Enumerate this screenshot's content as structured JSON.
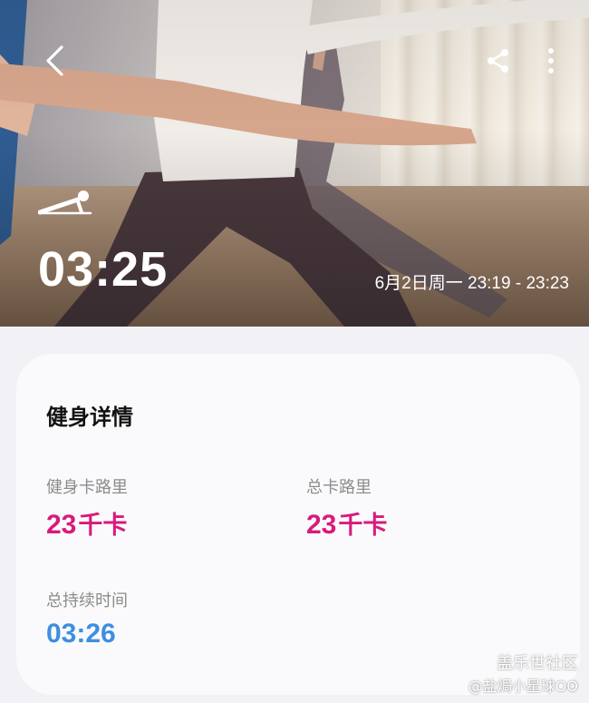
{
  "hero": {
    "duration": "03:25",
    "session_time": "6月2日周一 23:19 - 23:23"
  },
  "icons": {
    "back": "chevron-left-icon",
    "share": "share-icon",
    "more": "more-vertical-icon",
    "workout": "workout-plank-icon"
  },
  "details": {
    "title": "健身详情",
    "metrics": [
      {
        "label": "健身卡路里",
        "value": "23",
        "unit": "千卡"
      },
      {
        "label": "总卡路里",
        "value": "23",
        "unit": "千卡"
      },
      {
        "label": "总持续时间",
        "value": "03:26"
      }
    ]
  },
  "watermark": {
    "line1": "盖乐世社区",
    "line2": "@盐焗小星球OO"
  },
  "colors": {
    "calorie": "#d81b7a",
    "duration": "#3d8fe0",
    "card_bg": "#fafafc",
    "page_bg": "#f2f2f6"
  }
}
